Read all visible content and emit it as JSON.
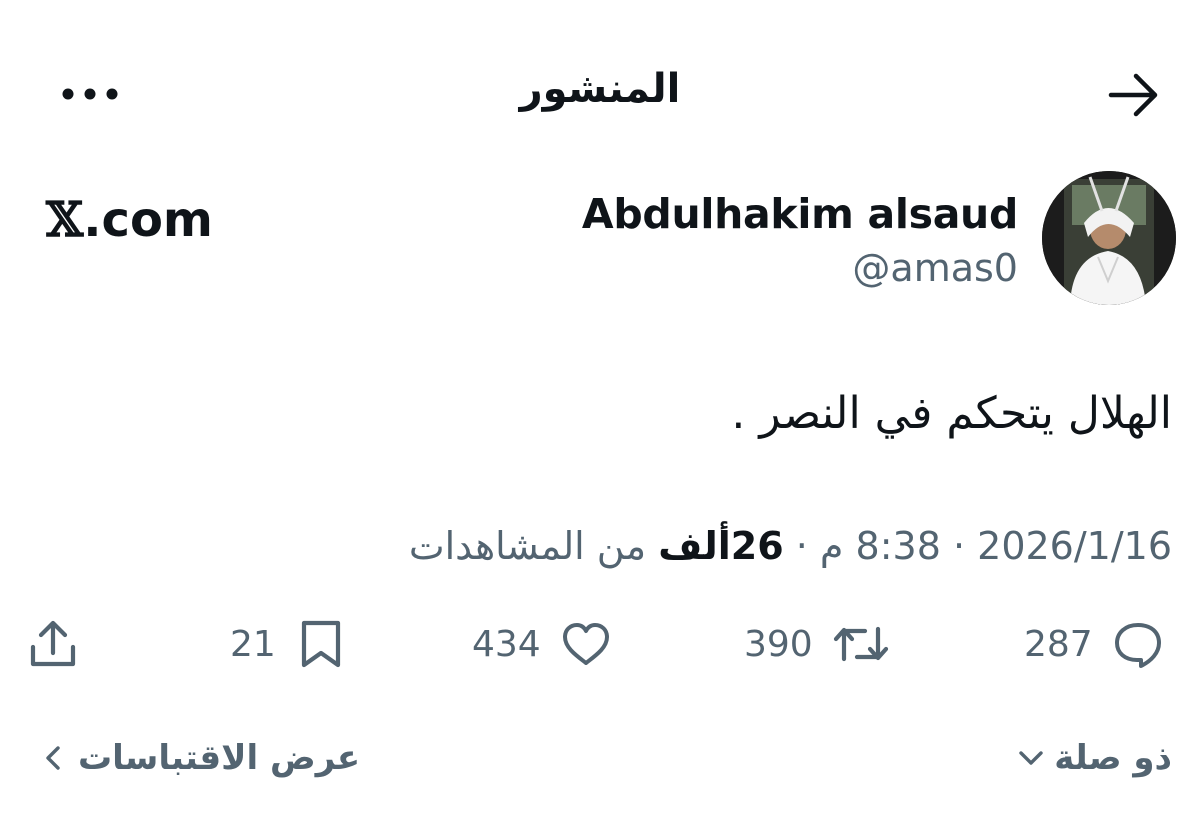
{
  "header": {
    "title": "المنشور",
    "back_icon": "arrow-right-icon",
    "more_icon": "more-horizontal-icon"
  },
  "author": {
    "display_name": "Abdulhakim alsaud",
    "handle": "@amas0"
  },
  "brand": {
    "x": "𝕏",
    "domain": ".com"
  },
  "tweet": {
    "text": "الهلال يتحكم في النصر ."
  },
  "meta": {
    "date": "2026/1/16",
    "time": "8:38 م",
    "separator": "·",
    "views_count": "26ألف",
    "views_label": "من المشاهدات"
  },
  "actions": {
    "replies": "287",
    "reposts": "390",
    "likes": "434",
    "bookmarks": "21"
  },
  "footer": {
    "related_label": "ذو صلة",
    "quotes_label": "عرض الاقتباسات"
  },
  "colors": {
    "text": "#0f1419",
    "secondary": "#536471",
    "background": "#ffffff"
  }
}
